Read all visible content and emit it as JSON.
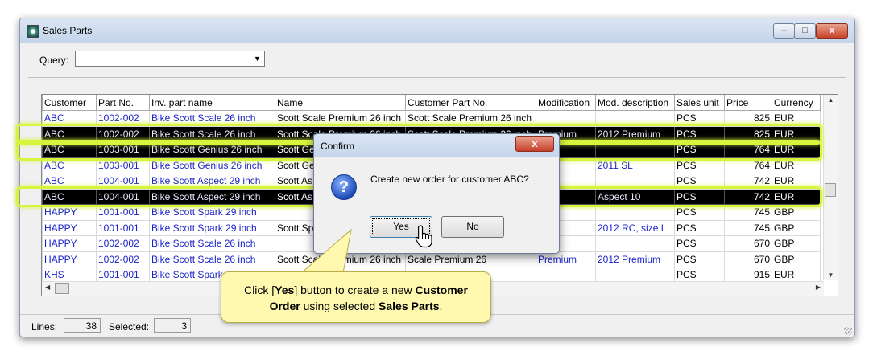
{
  "window": {
    "title": "Sales Parts",
    "min_glyph": "–",
    "max_glyph": "□",
    "close_glyph": "x"
  },
  "query": {
    "label": "Query:",
    "value": "",
    "arrow": "▼"
  },
  "table": {
    "columns": [
      "Customer",
      "Part No.",
      "Inv. part name",
      "Name",
      "Customer Part No.",
      "Modification",
      "Mod. description",
      "Sales unit",
      "Price",
      "Currency"
    ],
    "rows": [
      [
        "ABC",
        "1002-002",
        "Bike Scott Scale 26 inch",
        "Scott Scale Premium 26 inch",
        "Scott Scale Premium 26 inch",
        "",
        "",
        "PCS",
        "825",
        "EUR"
      ],
      [
        "ABC",
        "1002-002",
        "Bike Scott Scale 26 inch",
        "Scott Scale Premium 26 inch",
        "Scott Scale Premium 26 inch",
        "Premium",
        "2012 Premium",
        "PCS",
        "825",
        "EUR"
      ],
      [
        "ABC",
        "1003-001",
        "Bike Scott Genius 26 inch",
        "Scott Ge",
        "",
        "",
        "",
        "PCS",
        "764",
        "EUR"
      ],
      [
        "ABC",
        "1003-001",
        "Bike Scott Genius 26 inch",
        "Scott Ge",
        "",
        "",
        "2011 SL",
        "PCS",
        "764",
        "EUR"
      ],
      [
        "ABC",
        "1004-001",
        "Bike Scott Aspect 29 inch",
        "Scott As",
        "",
        "",
        "",
        "PCS",
        "742",
        "EUR"
      ],
      [
        "ABC",
        "1004-001",
        "Bike Scott Aspect 29 inch",
        "Scott As",
        "",
        "",
        "Aspect 10",
        "PCS",
        "742",
        "EUR"
      ],
      [
        "HAPPY",
        "1001-001",
        "Bike Scott Spark 29 inch",
        "",
        "",
        "",
        "",
        "PCS",
        "745",
        "GBP"
      ],
      [
        "HAPPY",
        "1001-001",
        "Bike Scott Spark 29 inch",
        "Scott Sp",
        "",
        "",
        "2012 RC, size L",
        "PCS",
        "745",
        "GBP"
      ],
      [
        "HAPPY",
        "1002-002",
        "Bike Scott Scale 26 inch",
        "",
        "",
        "",
        "",
        "PCS",
        "670",
        "GBP"
      ],
      [
        "HAPPY",
        "1002-002",
        "Bike Scott Scale 26 inch",
        "Scott Scale Premium 26 inch",
        "Scale Premium 26",
        "Premium",
        "2012 Premium",
        "PCS",
        "670",
        "GBP"
      ],
      [
        "KHS",
        "1001-001",
        "Bike Scott Spark",
        "",
        "",
        "",
        "",
        "PCS",
        "915",
        "EUR"
      ]
    ],
    "selected_rows": [
      1,
      2,
      5
    ]
  },
  "status": {
    "lines_label": "Lines:",
    "lines_value": "38",
    "selected_label": "Selected:",
    "selected_value": "3"
  },
  "dialog": {
    "title": "Confirm",
    "message": "Create new order for customer ABC?",
    "yes_label": "Yes",
    "no_label": "No",
    "close_glyph": "x",
    "icon_glyph": "?"
  },
  "callout": {
    "part1": "Click [",
    "bold1": "Yes",
    "part2": "] button to create a new ",
    "bold2": "Customer Order",
    "part3": " using selected ",
    "bold3": "Sales Parts",
    "part4": "."
  },
  "colors": {
    "link_text": "#1a22c8",
    "highlight": "#d6f53c",
    "callout_bg": "#fff9b0"
  }
}
